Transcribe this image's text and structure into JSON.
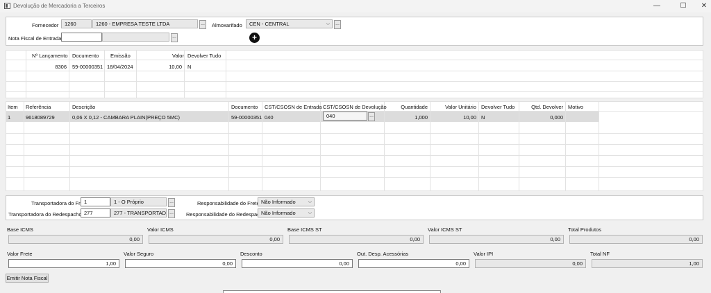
{
  "window": {
    "title": "Devolução de Mercadoria a Terceiros",
    "minimize": "—",
    "maximize": "☐",
    "close": "✕"
  },
  "header": {
    "fornecedor_label": "Fornecedor",
    "fornecedor_code": "1260",
    "fornecedor_name": "1260 - EMPRESA TESTE LTDA",
    "almoxarifado_label": "Almoxarifado",
    "almoxarifado_value": "CEN - CENTRAL",
    "nf_entrada_label": "Nota Fiscal de Entrada",
    "nf_entrada_value": "",
    "nf_entrada_desc": "",
    "add_button": "+",
    "dots": "..."
  },
  "nf_grid": {
    "headers": [
      "Nº Lançamento",
      "Documento",
      "Emissão",
      "Valor",
      "Devolver Tudo"
    ],
    "rows": [
      {
        "lancamento": "8306",
        "documento": "59-00000351",
        "emissao": "18/04/2024",
        "valor": "10,00",
        "devolver": "N"
      }
    ]
  },
  "items_grid": {
    "headers": [
      "Item",
      "Referência",
      "Descrição",
      "Documento",
      "CST/CSOSN de Entrada",
      "CST/CSOSN de Devolução",
      "Quantidade",
      "Valor Unitário",
      "Devolver Tudo",
      "Qtd. Devolver",
      "Motivo"
    ],
    "rows": [
      {
        "item": "1",
        "referencia": "9618089729",
        "descricao": "0,06 X 0,12 - CAMBARA PLAIN(PREÇO 5MC)",
        "documento": "59-00000351",
        "cst_entrada": "040",
        "cst_devolucao": "040",
        "quantidade": "1,000",
        "valor_unitario": "10,00",
        "devolver_tudo": "N",
        "qtd_devolver": "0,000",
        "motivo": ""
      }
    ]
  },
  "transport": {
    "frete_label": "Transportadora do Frete",
    "frete_code": "1",
    "frete_name": "1 - O Próprio",
    "redespacho_label": "Transportadora do Redespacho",
    "redespacho_code": "277",
    "redespacho_name": "277 - TRANSPORTADOR",
    "resp_frete_label": "Responsabilidade do Frete",
    "resp_frete_value": "Não Informado",
    "resp_redespacho_label": "Responsabilidade do Redespacho",
    "resp_redespacho_value": "Não Informado"
  },
  "totals": {
    "base_icms_label": "Base ICMS",
    "base_icms": "0,00",
    "valor_icms_label": "Valor ICMS",
    "valor_icms": "0,00",
    "base_icms_st_label": "Base ICMS ST",
    "base_icms_st": "0,00",
    "valor_icms_st_label": "Valor ICMS ST",
    "valor_icms_st": "0,00",
    "total_produtos_label": "Total Produtos",
    "total_produtos": "0,00",
    "valor_frete_label": "Valor Frete",
    "valor_frete": "1,00",
    "valor_seguro_label": "Valor Seguro",
    "valor_seguro": "0,00",
    "desconto_label": "Desconto",
    "desconto": "0,00",
    "out_desp_label": "Out. Desp. Acessórias",
    "out_desp": "0,00",
    "valor_ipi_label": "Valor IPI",
    "valor_ipi": "0,00",
    "total_nf_label": "Total NF",
    "total_nf": "1,00"
  },
  "actions": {
    "emitir_label": "Emitir Nota Fiscal"
  }
}
